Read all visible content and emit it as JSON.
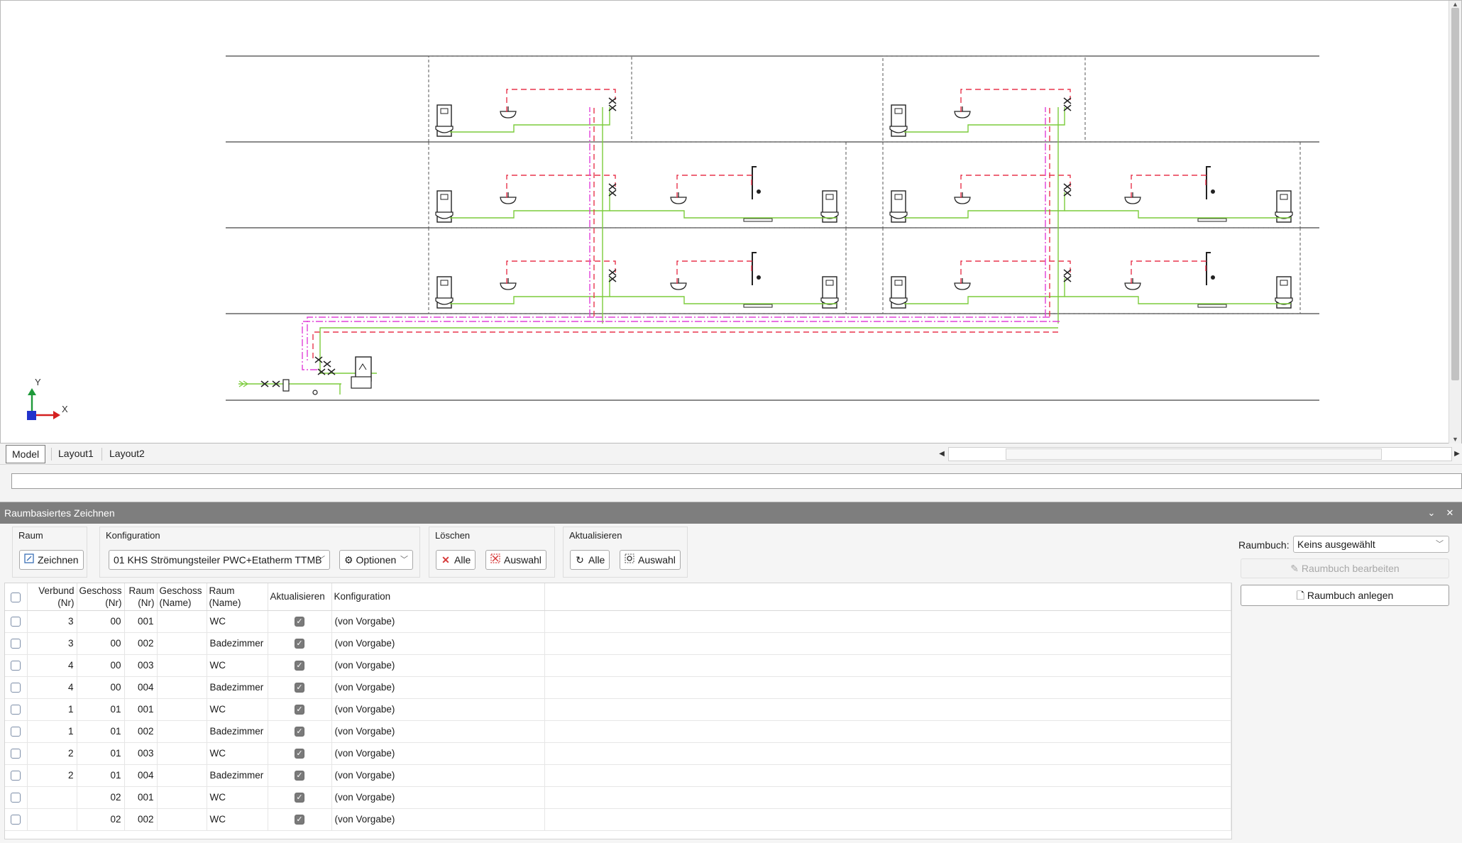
{
  "tabs": [
    {
      "label": "Model",
      "active": true
    },
    {
      "label": "Layout1",
      "active": false
    },
    {
      "label": "Layout2",
      "active": false
    }
  ],
  "axis": {
    "y": "Y",
    "x": "X"
  },
  "panel": {
    "title": "Raumbasiertes Zeichnen",
    "groups": {
      "raum": {
        "label": "Raum",
        "zeichnen": "Zeichnen"
      },
      "konfiguration": {
        "label": "Konfiguration",
        "selected": "01 KHS Strömungsteiler PWC+Etatherm TTMB",
        "optionen": "Optionen"
      },
      "loeschen": {
        "label": "Löschen",
        "alle": "Alle",
        "auswahl": "Auswahl"
      },
      "aktualisieren": {
        "label": "Aktualisieren",
        "alle": "Alle",
        "auswahl": "Auswahl"
      }
    },
    "raumbuch": {
      "label": "Raumbuch:",
      "selected": "Keins ausgewählt",
      "edit": "Raumbuch bearbeiten",
      "new": "Raumbuch anlegen"
    }
  },
  "table": {
    "columns": [
      {
        "key": "verbund",
        "line1": "Verbund",
        "line2": "(Nr)"
      },
      {
        "key": "geschoss_nr",
        "line1": "Geschoss",
        "line2": "(Nr)"
      },
      {
        "key": "raum_nr",
        "line1": "Raum",
        "line2": "(Nr)"
      },
      {
        "key": "geschoss_name",
        "line1": "Geschoss",
        "line2": "(Name)"
      },
      {
        "key": "raum_name",
        "line1": "Raum",
        "line2": "(Name)"
      },
      {
        "key": "aktualisieren",
        "line1": "Aktualisieren",
        "line2": ""
      },
      {
        "key": "konfiguration",
        "line1": "Konfiguration",
        "line2": ""
      }
    ],
    "rows": [
      {
        "verbund": "3",
        "geschoss_nr": "00",
        "raum_nr": "001",
        "geschoss_name": "",
        "raum_name": "WC",
        "aktualisieren": true,
        "konfiguration": "(von Vorgabe)"
      },
      {
        "verbund": "3",
        "geschoss_nr": "00",
        "raum_nr": "002",
        "geschoss_name": "",
        "raum_name": "Badezimmer",
        "aktualisieren": true,
        "konfiguration": "(von Vorgabe)"
      },
      {
        "verbund": "4",
        "geschoss_nr": "00",
        "raum_nr": "003",
        "geschoss_name": "",
        "raum_name": "WC",
        "aktualisieren": true,
        "konfiguration": "(von Vorgabe)"
      },
      {
        "verbund": "4",
        "geschoss_nr": "00",
        "raum_nr": "004",
        "geschoss_name": "",
        "raum_name": "Badezimmer",
        "aktualisieren": true,
        "konfiguration": "(von Vorgabe)"
      },
      {
        "verbund": "1",
        "geschoss_nr": "01",
        "raum_nr": "001",
        "geschoss_name": "",
        "raum_name": "WC",
        "aktualisieren": true,
        "konfiguration": "(von Vorgabe)"
      },
      {
        "verbund": "1",
        "geschoss_nr": "01",
        "raum_nr": "002",
        "geschoss_name": "",
        "raum_name": "Badezimmer",
        "aktualisieren": true,
        "konfiguration": "(von Vorgabe)"
      },
      {
        "verbund": "2",
        "geschoss_nr": "01",
        "raum_nr": "003",
        "geschoss_name": "",
        "raum_name": "WC",
        "aktualisieren": true,
        "konfiguration": "(von Vorgabe)"
      },
      {
        "verbund": "2",
        "geschoss_nr": "01",
        "raum_nr": "004",
        "geschoss_name": "",
        "raum_name": "Badezimmer",
        "aktualisieren": true,
        "konfiguration": "(von Vorgabe)"
      },
      {
        "verbund": "",
        "geschoss_nr": "02",
        "raum_nr": "001",
        "geschoss_name": "",
        "raum_name": "WC",
        "aktualisieren": true,
        "konfiguration": "(von Vorgabe)"
      },
      {
        "verbund": "",
        "geschoss_nr": "02",
        "raum_nr": "002",
        "geschoss_name": "",
        "raum_name": "WC",
        "aktualisieren": true,
        "konfiguration": "(von Vorgabe)"
      }
    ]
  },
  "colors": {
    "hot_water": "#e8354d",
    "cold_water": "#7ccc3c",
    "circulation": "#e040d8",
    "panel_title_bg": "#7e7e7e"
  }
}
